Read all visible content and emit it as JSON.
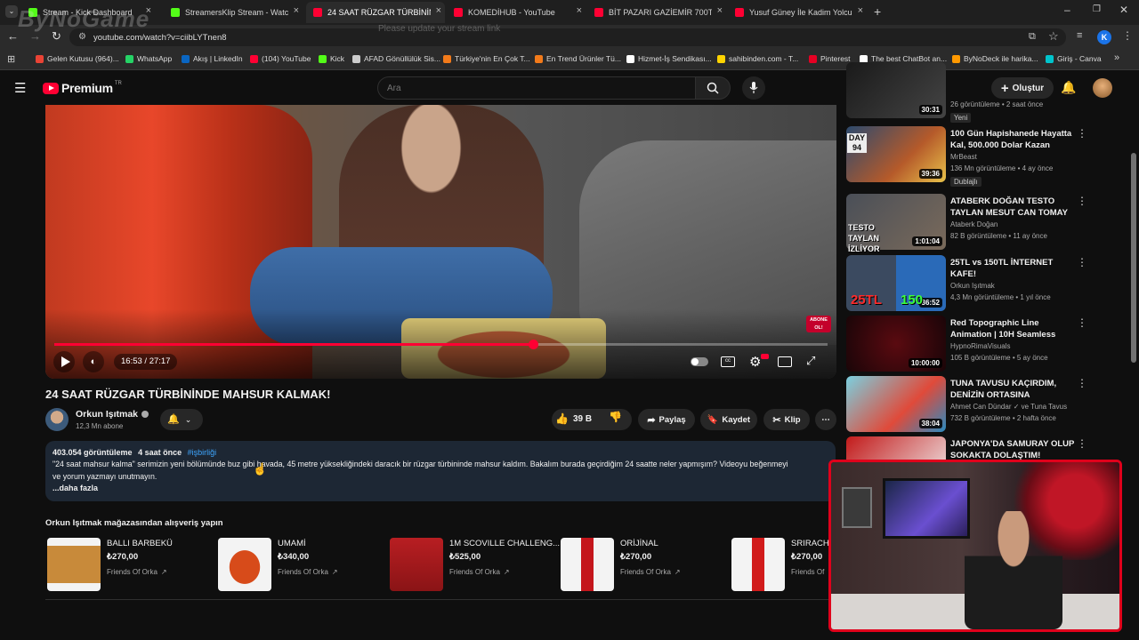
{
  "browser": {
    "tabs": [
      {
        "label": "Stream - Kick Dashboard",
        "color": "#53fc18"
      },
      {
        "label": "StreamersKlip Stream - Watch L",
        "color": "#53fc18"
      },
      {
        "label": "24 SAAT RÜZGAR TÜRBİNİNDE",
        "color": "#ff0033"
      },
      {
        "label": "KOMEDİHUB - YouTube",
        "color": "#ff0033"
      },
      {
        "label": "BİT PAZARI GAZİEMİR 700TL İLE",
        "color": "#ff0033"
      },
      {
        "label": "Yusuf Güney İle Kadim Yolculuk",
        "color": "#ff0033"
      }
    ],
    "watermark": "ByNoGame",
    "url": "youtube.com/watch?v=ciibLYTnen8",
    "ghost_text": "Please update your stream link",
    "profile_initial": "K",
    "bookmarks": [
      {
        "label": "Gelen Kutusu (964)...",
        "color": "#ea4335"
      },
      {
        "label": "WhatsApp",
        "color": "#25d366"
      },
      {
        "label": "Akış | LinkedIn",
        "color": "#0a66c2"
      },
      {
        "label": "(104) YouTube",
        "color": "#ff0033"
      },
      {
        "label": "Kick",
        "color": "#53fc18"
      },
      {
        "label": "AFAD Gönüllülük Sis...",
        "color": "#cccccc"
      },
      {
        "label": "Türkiye'nin En Çok T...",
        "color": "#f27a1a"
      },
      {
        "label": "En Trend Ürünler Tü...",
        "color": "#f27a1a"
      },
      {
        "label": "Hizmet-İş Sendikası...",
        "color": "#ffffff"
      },
      {
        "label": "sahibinden.com - T...",
        "color": "#ffd400"
      },
      {
        "label": "Pinterest",
        "color": "#e60023"
      },
      {
        "label": "The best ChatBot an...",
        "color": "#ffffff"
      },
      {
        "label": "ByNoDeck ile harika...",
        "color": "#ff9900"
      },
      {
        "label": "Giriş - Canva",
        "color": "#00c4cc"
      }
    ]
  },
  "youtube": {
    "logo": "Premium",
    "logo_sup": "TR",
    "search_placeholder": "Ara",
    "create_label": "Oluştur",
    "player": {
      "time": "16:53 / 27:17",
      "progress": 0.619,
      "overlay_badge": "ABONE OL!"
    },
    "video": {
      "title": "24 SAAT RÜZGAR TÜRBİNİNDE MAHSUR KALMAK!",
      "channel": "Orkun Işıtmak",
      "subscribers": "12,3 Mn abone",
      "likes": "39 B",
      "share": "Paylaş",
      "save": "Kaydet",
      "clip": "Klip",
      "views": "403.054 görüntüleme",
      "age": "4 saat önce",
      "tag": "#işbirliği",
      "description_line1": "\"24 saat mahsur kalma\" serimizin yeni bölümünde buz gibi havada, 45 metre yüksekliğindeki daracık bir rüzgar türbininde mahsur kaldım. Bakalım burada geçirdiğim 24 saatte neler yapmışım? Videoyu beğenmeyi",
      "description_line2": "ve yorum yazmayı unutmayın.",
      "more": "...daha fazla"
    },
    "shop": {
      "heading": "Orkun Işıtmak mağazasından alışveriş yapın",
      "products": [
        {
          "name": "BALLI BARBEKÜ",
          "price": "₺270,00",
          "seller": "Friends Of Orka"
        },
        {
          "name": "UMAMİ",
          "price": "₺340,00",
          "seller": "Friends Of Orka"
        },
        {
          "name": "1M SCOVILLE CHALLENG...",
          "price": "₺525,00",
          "seller": "Friends Of Orka"
        },
        {
          "name": "ORİJİNAL",
          "price": "₺270,00",
          "seller": "Friends Of Orka"
        },
        {
          "name": "SRIRACH",
          "price": "₺270,00",
          "seller": "Friends Of"
        }
      ]
    },
    "recommendations": [
      {
        "title": "",
        "channel": "",
        "meta": "26 görüntüleme • 2 saat önce",
        "badge": "Yeni",
        "duration": "30:31"
      },
      {
        "title": "100 Gün Hapishanede Hayatta Kal, 500.000 Dolar Kazan",
        "channel": "MrBeast",
        "meta": "136 Mn görüntüleme • 4 ay önce",
        "badge": "Dublajlı",
        "duration": "39:36"
      },
      {
        "title": "ATABERK DOĞAN TESTO TAYLAN MESUT CAN TOMAY ...",
        "channel": "Ataberk Doğan",
        "meta": "82 B görüntüleme • 11 ay önce",
        "badge": "",
        "duration": "1:01:04"
      },
      {
        "title": "25TL vs 150TL İNTERNET KAFE!",
        "channel": "Orkun Işıtmak",
        "meta": "4,3 Mn görüntüleme • 1 yıl önce",
        "badge": "",
        "duration": "36:52"
      },
      {
        "title": "Red Topographic Line Animation | 10H Seamless Lo...",
        "channel": "HypnoRimaVisuals",
        "meta": "105 B görüntüleme • 5 ay önce",
        "badge": "",
        "duration": "10:00:00"
      },
      {
        "title": "TUNA TAVUSU KAÇIRDIM, DENİZİN ORTASINA BIRAKTIM...",
        "channel": "Ahmet Can Dündar ✓ ve Tuna Tavus",
        "meta": "732 B görüntüleme • 2 hafta önce",
        "badge": "",
        "duration": "38:04"
      },
      {
        "title": "JAPONYA'DA SAMURAY OLUP SOKAKTA DOLAŞTIM! (EFSAN...",
        "channel": "",
        "meta": "",
        "badge": "",
        "duration": ""
      }
    ],
    "thumb_texts": {
      "day": "DAY 94",
      "testo": "TESTO TAYLAN İZLİYOR",
      "price1": "25TL",
      "price2": "150"
    }
  }
}
